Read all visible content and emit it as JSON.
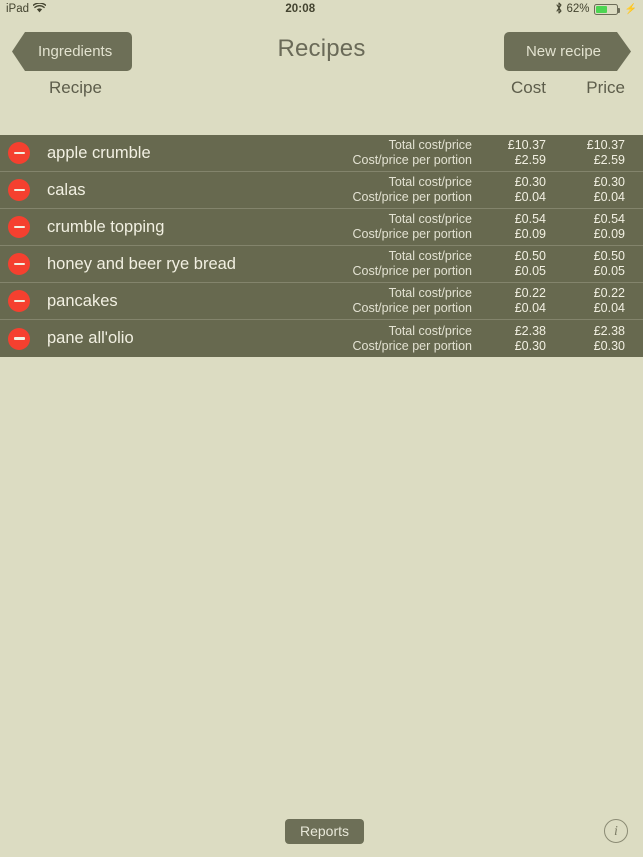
{
  "status_bar": {
    "device": "iPad",
    "wifi_icon": "wifi-icon",
    "time": "20:08",
    "bluetooth_icon": "bluetooth-icon",
    "battery_text": "62%",
    "battery_level": 62,
    "charging_icon": "charging-bolt-icon"
  },
  "nav": {
    "back_label": "Ingredients",
    "title": "Recipes",
    "new_label": "New recipe"
  },
  "columns": {
    "recipe": "Recipe",
    "cost": "Cost",
    "price": "Price"
  },
  "row_labels": {
    "total": "Total cost/price",
    "per_portion": "Cost/price per portion"
  },
  "rows": [
    {
      "name": "apple crumble",
      "total_cost": "£10.37",
      "total_price": "£10.37",
      "portion_cost": "£2.59",
      "portion_price": "£2.59"
    },
    {
      "name": "calas",
      "total_cost": "£0.30",
      "total_price": "£0.30",
      "portion_cost": "£0.04",
      "portion_price": "£0.04"
    },
    {
      "name": "crumble topping",
      "total_cost": "£0.54",
      "total_price": "£0.54",
      "portion_cost": "£0.09",
      "portion_price": "£0.09"
    },
    {
      "name": "honey and beer rye bread",
      "total_cost": "£0.50",
      "total_price": "£0.50",
      "portion_cost": "£0.05",
      "portion_price": "£0.05"
    },
    {
      "name": "pancakes",
      "total_cost": "£0.22",
      "total_price": "£0.22",
      "portion_cost": "£0.04",
      "portion_price": "£0.04"
    },
    {
      "name": "pane all'olio",
      "total_cost": "£2.38",
      "total_price": "£2.38",
      "portion_cost": "£0.30",
      "portion_price": "£0.30"
    }
  ],
  "toolbar": {
    "reports_label": "Reports",
    "info_label": "i"
  },
  "colors": {
    "page_background": "#dcdcc2",
    "row_background": "#67694f",
    "button_background": "#6d6f57",
    "delete_red": "#f5402f",
    "battery_green": "#4cd552",
    "text_light": "#f2f0e2",
    "text_dark": "#5d5d4b"
  }
}
